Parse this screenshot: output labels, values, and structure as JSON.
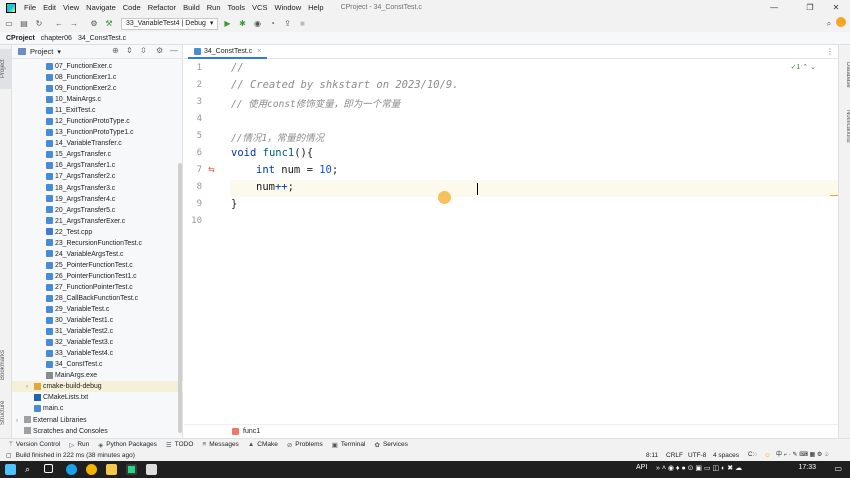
{
  "menubar": {
    "items": [
      "File",
      "Edit",
      "View",
      "Navigate",
      "Code",
      "Refactor",
      "Build",
      "Run",
      "Tools",
      "VCS",
      "Window",
      "Help"
    ],
    "title": "CProject - 34_ConstTest.c"
  },
  "toolbar": {
    "run_config": "33_VariableTest4 | Debug"
  },
  "breadcrumb": [
    "CProject",
    "chapter06",
    "34_ConstTest.c"
  ],
  "project_panel": {
    "title": "Project",
    "files": [
      "07_FunctionExer.c",
      "08_FunctionExer1.c",
      "09_FunctionExer2.c",
      "10_MainArgs.c",
      "11_ExitTest.c",
      "12_FunctionProtoType.c",
      "13_FunctionProtoType1.c",
      "14_VariableTransfer.c",
      "15_ArgsTransfer.c",
      "16_ArgsTransfer1.c",
      "17_ArgsTransfer2.c",
      "18_ArgsTransfer3.c",
      "19_ArgsTransfer4.c",
      "20_ArgsTransfer5.c",
      "21_ArgsTransferExer.c",
      "22_Test.cpp",
      "23_RecursionFunctionTest.c",
      "24_VariableArgsTest.c",
      "25_PointerFunctionTest.c",
      "26_PointerFunctionTest1.c",
      "27_FunctionPointerTest.c",
      "28_CallBackFunctionTest.c",
      "29_VariableTest.c",
      "30_VariableTest1.c",
      "31_VariableTest2.c",
      "32_VariableTest3.c",
      "33_VariableTest4.c",
      "34_ConstTest.c",
      "MainArgs.exe"
    ],
    "other": [
      "cmake-build-debug",
      "CMakeLists.txt",
      "main.c",
      "External Libraries",
      "Scratches and Consoles"
    ]
  },
  "editor": {
    "tab": "34_ConstTest.c",
    "line_numbers": [
      "1",
      "2",
      "3",
      "4",
      "5",
      "6",
      "7",
      "8",
      "9",
      "10"
    ],
    "lines": {
      "l1": "//",
      "l2": "// Created by shkstart on 2023/10/9.",
      "l3a": "// 使用",
      "l3b": "const",
      "l3c": "修饰变量，即为一个常量",
      "l5": "//情况1，常量的情况",
      "l6_kw": "void",
      "l6_fn": "func1",
      "l6_rest": "(){",
      "l7_kw": "int",
      "l7_mid": " num = ",
      "l7_num": "10",
      "l7_end": ";",
      "l8_var": "num",
      "l8_op": "++",
      "l8_end": ";",
      "l9": "}"
    },
    "inspection": "✓1",
    "function_crumb": "func1"
  },
  "right_strip": [
    "Database",
    "Notifications"
  ],
  "left_strip": [
    "Project",
    "Bookmarks",
    "Structure"
  ],
  "tool_windows": [
    "Version Control",
    "Run",
    "Python Packages",
    "TODO",
    "Messages",
    "CMake",
    "Problems",
    "Terminal",
    "Services"
  ],
  "status": {
    "message": "Build finished in 222 ms (38 minutes ago)",
    "position": "8:11",
    "line_sep": "CRLF",
    "encoding": "UTF-8",
    "indent": "4 spaces"
  },
  "taskbar": {
    "api": "API",
    "time": "17:33"
  },
  "colors": {
    "keyword": "#0033b3",
    "function": "#00627a",
    "number": "#1750eb",
    "comment": "#8c8c8c",
    "accent": "#3574f0"
  }
}
